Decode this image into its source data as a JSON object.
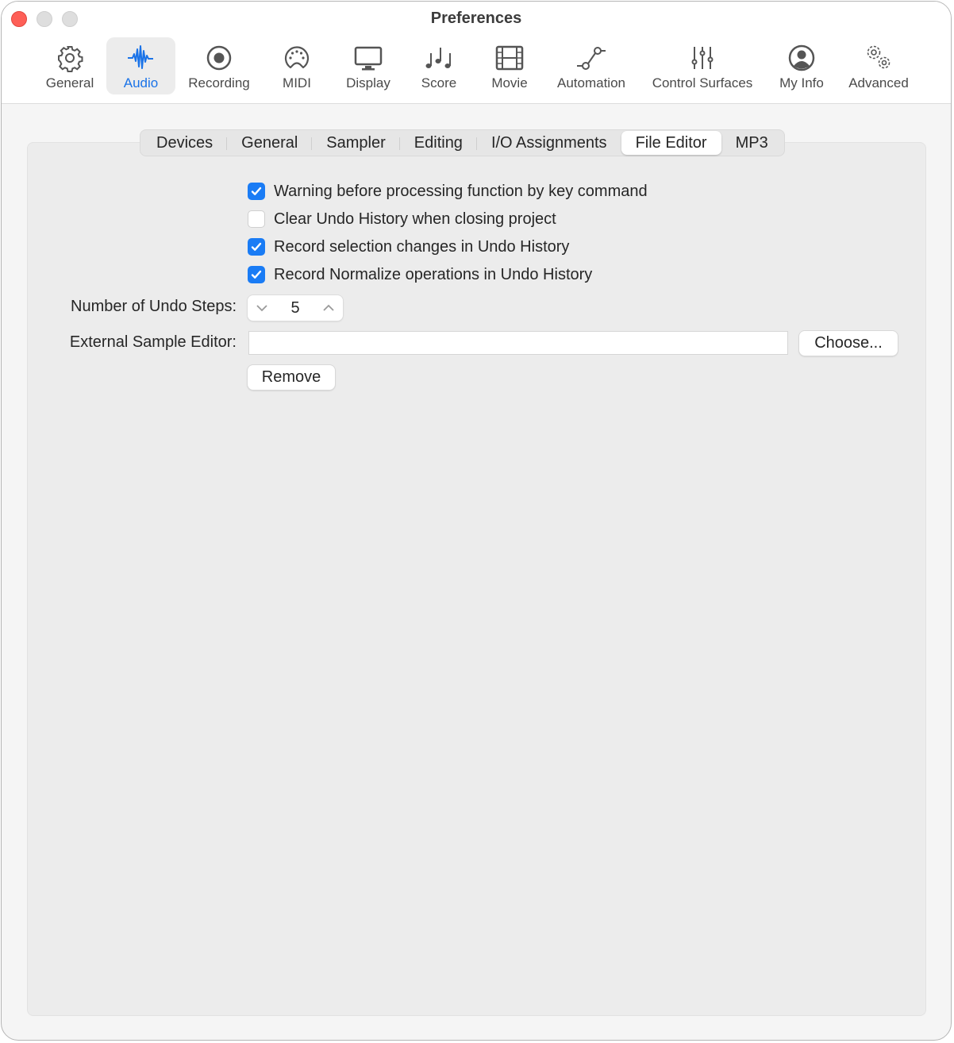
{
  "window": {
    "title": "Preferences"
  },
  "toolbar": {
    "items": [
      {
        "label": "General",
        "icon": "gear-icon",
        "active": false
      },
      {
        "label": "Audio",
        "icon": "waveform-icon",
        "active": true
      },
      {
        "label": "Recording",
        "icon": "record-icon",
        "active": false
      },
      {
        "label": "MIDI",
        "icon": "midi-connector-icon",
        "active": false
      },
      {
        "label": "Display",
        "icon": "monitor-icon",
        "active": false
      },
      {
        "label": "Score",
        "icon": "music-notes-icon",
        "active": false
      },
      {
        "label": "Movie",
        "icon": "film-icon",
        "active": false
      },
      {
        "label": "Automation",
        "icon": "automation-curve-icon",
        "active": false
      },
      {
        "label": "Control Surfaces",
        "icon": "sliders-icon",
        "active": false
      },
      {
        "label": "My Info",
        "icon": "user-icon",
        "active": false
      },
      {
        "label": "Advanced",
        "icon": "gears-icon",
        "active": false
      }
    ]
  },
  "tabs": {
    "items": [
      {
        "label": "Devices",
        "active": false
      },
      {
        "label": "General",
        "active": false
      },
      {
        "label": "Sampler",
        "active": false
      },
      {
        "label": "Editing",
        "active": false
      },
      {
        "label": "I/O Assignments",
        "active": false
      },
      {
        "label": "File Editor",
        "active": true
      },
      {
        "label": "MP3",
        "active": false
      }
    ]
  },
  "file_editor": {
    "checkboxes": [
      {
        "label": "Warning before processing function by key command",
        "checked": true
      },
      {
        "label": "Clear Undo History when closing project",
        "checked": false
      },
      {
        "label": "Record selection changes in Undo History",
        "checked": true
      },
      {
        "label": "Record Normalize operations in Undo History",
        "checked": true
      }
    ],
    "undo_steps": {
      "label": "Number of Undo Steps:",
      "value": "5"
    },
    "external_editor": {
      "label": "External Sample Editor:",
      "value": "",
      "choose_label": "Choose...",
      "remove_label": "Remove"
    }
  },
  "colors": {
    "accent": "#1a7cf5",
    "close": "#fe5f57"
  }
}
